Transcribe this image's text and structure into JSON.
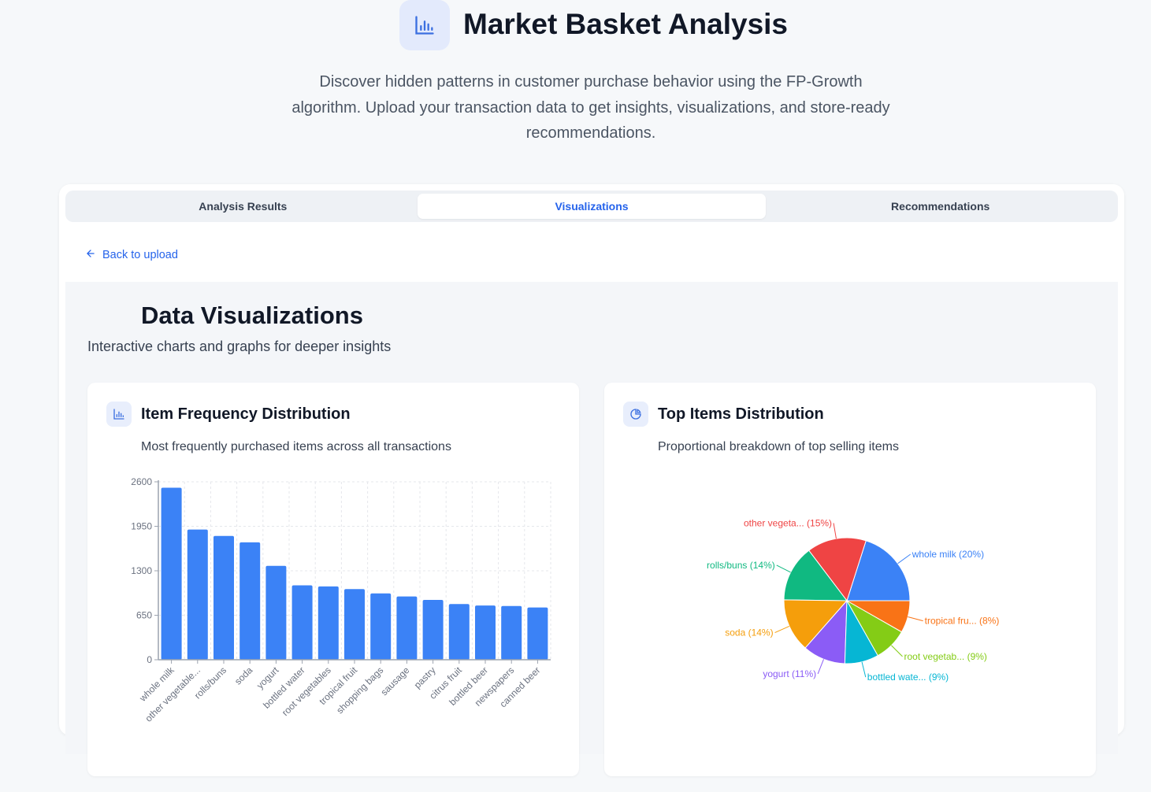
{
  "header": {
    "title": "Market Basket Analysis",
    "description": "Discover hidden patterns in customer purchase behavior using the FP-Growth algorithm. Upload your transaction data to get insights, visualizations, and store-ready recommendations.",
    "icon": "bar-chart-icon"
  },
  "tabs": [
    {
      "label": "Analysis Results"
    },
    {
      "label": "Visualizations",
      "active": true
    },
    {
      "label": "Recommendations"
    }
  ],
  "back_link": "Back to upload",
  "section": {
    "title": "Data Visualizations",
    "subtitle": "Interactive charts and graphs for deeper insights"
  },
  "accent": "#2563eb",
  "chart_data": [
    {
      "type": "bar",
      "title": "Item Frequency Distribution",
      "subtitle": "Most frequently purchased items across all transactions",
      "categories": [
        "whole milk",
        "other vegetable...",
        "rolls/buns",
        "soda",
        "yogurt",
        "bottled water",
        "root vegetables",
        "tropical fruit",
        "shopping bags",
        "sausage",
        "pastry",
        "citrus fruit",
        "bottled beer",
        "newspapers",
        "canned beer"
      ],
      "values": [
        2513,
        1903,
        1809,
        1715,
        1372,
        1087,
        1072,
        1032,
        969,
        924,
        875,
        814,
        792,
        785,
        764
      ],
      "yticks": [
        0,
        650,
        1300,
        1950,
        2600
      ],
      "ylim": [
        0,
        2600
      ],
      "grid": true,
      "color": "#3b82f6"
    },
    {
      "type": "pie",
      "title": "Top Items Distribution",
      "subtitle": "Proportional breakdown of top selling items",
      "labels": [
        "whole milk (20%)",
        "other vegeta... (15%)",
        "rolls/buns (14%)",
        "soda (14%)",
        "yogurt (11%)",
        "bottled wate... (9%)",
        "root vegetab... (9%)",
        "tropical fru... (8%)"
      ],
      "values": [
        2513,
        1903,
        1809,
        1715,
        1372,
        1087,
        1072,
        1032
      ],
      "colors": [
        "#3b82f6",
        "#ef4444",
        "#10b981",
        "#f59e0b",
        "#8b5cf6",
        "#06b6d4",
        "#84cc16",
        "#f97316"
      ]
    }
  ]
}
